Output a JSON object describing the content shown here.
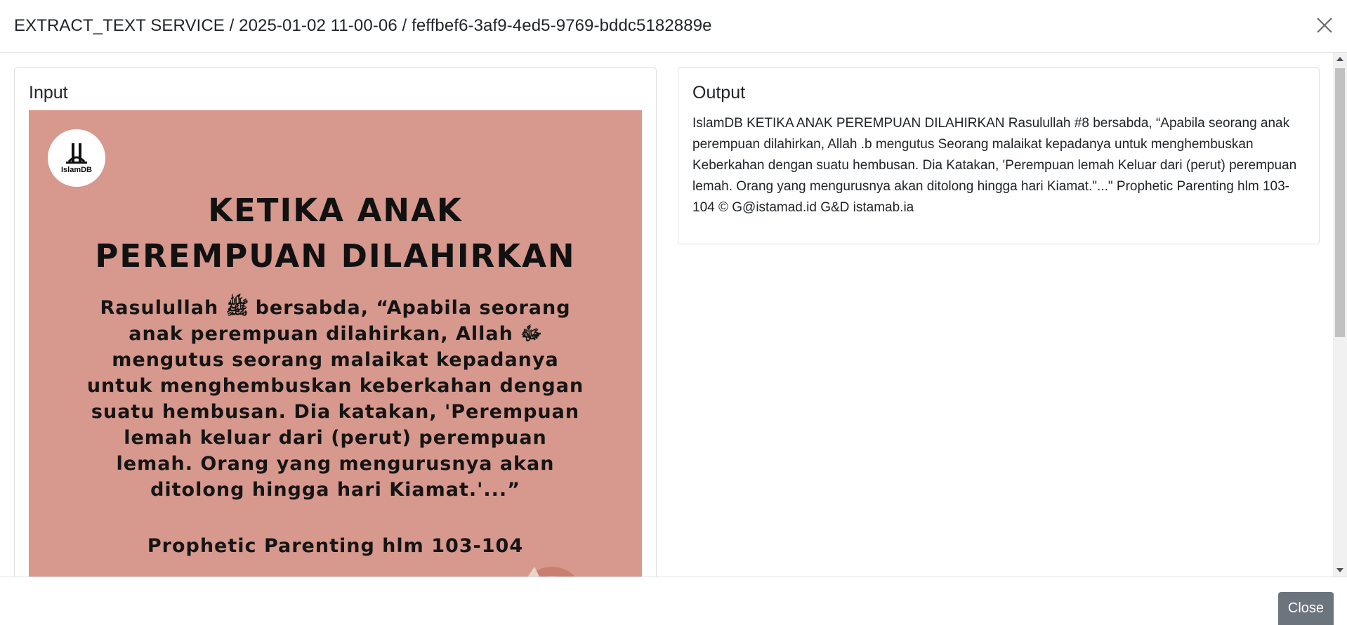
{
  "header": {
    "title": "EXTRACT_TEXT SERVICE / 2025-01-02 11-00-06 / feffbef6-3af9-4ed5-9769-bddc5182889e",
    "close_icon": "close-x-icon"
  },
  "input_card": {
    "title": "Input",
    "image": {
      "logo_text": "IslamDB",
      "title_lines": [
        "KETIKA ANAK",
        "PEREMPUAN DILAHIRKAN"
      ],
      "body_lines": [
        "Rasulullah ﷺ bersabda, “Apabila seorang",
        "anak perempuan dilahirkan, Allah ﷻ",
        "mengutus seorang malaikat kepadanya",
        "untuk menghembuskan keberkahan dengan",
        "suatu hembusan. Dia katakan, 'Perempuan",
        "lemah keluar dari (perut) perempuan",
        "lemah. Orang yang mengurusnya akan",
        "ditolong hingga hari Kiamat.'...”"
      ],
      "source": "Prophetic Parenting hlm 103-104",
      "background_color": "#d7988d"
    }
  },
  "output_card": {
    "title": "Output",
    "text": "IslamDB KETIKA ANAK PEREMPUAN DILAHIRKAN Rasulullah #8 bersabda, “Apabila seorang anak perempuan dilahirkan, Allah .b mengutus Seorang malaikat kepadanya untuk menghembuskan Keberkahan dengan suatu hembusan. Dia Katakan, 'Perempuan lemah Keluar dari (perut) perempuan lemah. Orang yang mengurusnya akan ditolong hingga hari Kiamat.\"...\" Prophetic Parenting hlm 103-104 © G@istamad.id G&D istamab.ia"
  },
  "footer": {
    "close_label": "Close"
  },
  "colors": {
    "button_secondary": "#6c757d",
    "border": "#dee2e6"
  }
}
